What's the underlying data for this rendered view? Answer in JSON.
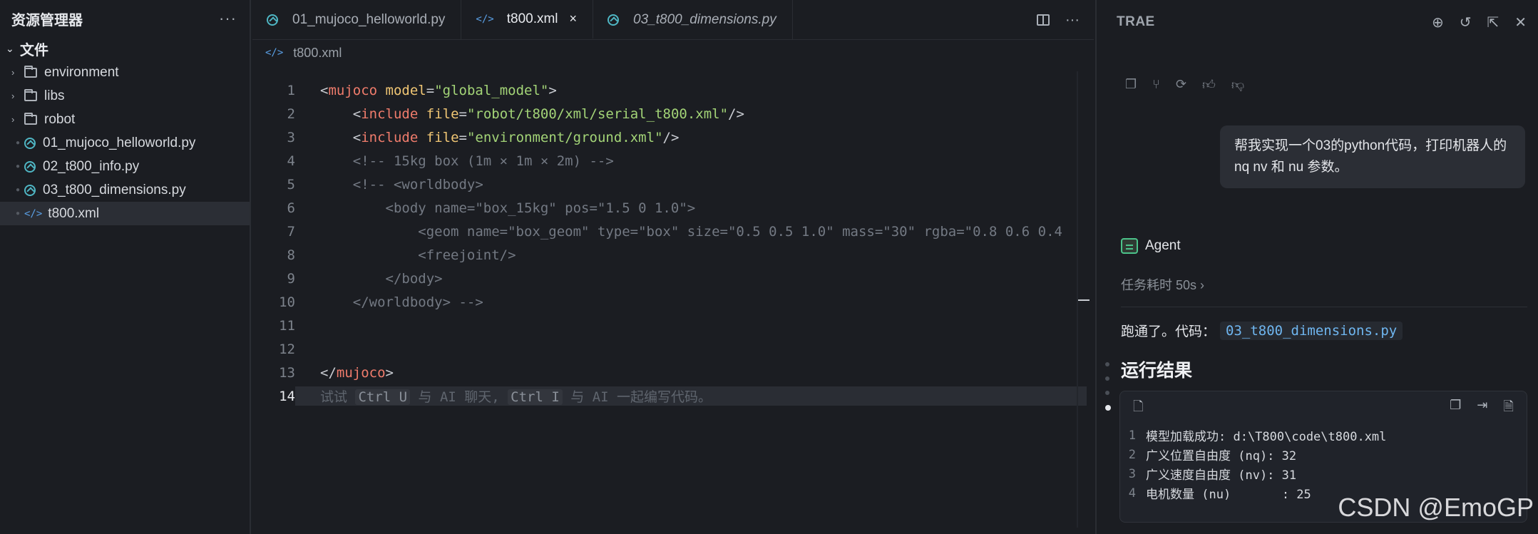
{
  "sidebar": {
    "title": "资源管理器",
    "more": "···",
    "root": "文件",
    "items": [
      {
        "type": "folder",
        "label": "environment"
      },
      {
        "type": "folder",
        "label": "libs"
      },
      {
        "type": "folder",
        "label": "robot"
      },
      {
        "type": "py",
        "label": "01_mujoco_helloworld.py"
      },
      {
        "type": "py",
        "label": "02_t800_info.py"
      },
      {
        "type": "py",
        "label": "03_t800_dimensions.py"
      },
      {
        "type": "xml",
        "label": "t800.xml"
      }
    ]
  },
  "editor": {
    "tabs": [
      {
        "label": "01_mujoco_helloworld.py"
      },
      {
        "label": "t800.xml",
        "close": "×"
      },
      {
        "label": "03_t800_dimensions.py"
      }
    ],
    "tab_more": "···",
    "breadcrumb": "t800.xml",
    "xml_glyph": "</>",
    "line_numbers": [
      "1",
      "2",
      "3",
      "4",
      "5",
      "6",
      "7",
      "8",
      "9",
      "10",
      "11",
      "12",
      "13",
      "14"
    ],
    "lines": {
      "l1": {
        "a": "<",
        "b": "mujoco",
        "c": " ",
        "d": "model",
        "e": "=",
        "f": "\"global_model\"",
        "g": ">"
      },
      "l2": {
        "indent": "    ",
        "a": "<",
        "b": "include",
        "c": " ",
        "d": "file",
        "e": "=",
        "f": "\"robot/t800/xml/serial_t800.xml\"",
        "g": "/>"
      },
      "l3": {
        "indent": "    ",
        "a": "<",
        "b": "include",
        "c": " ",
        "d": "file",
        "e": "=",
        "f": "\"environment/ground.xml\"",
        "g": "/>"
      },
      "l4": "    <!-- 15kg box (1m × 1m × 2m) -->",
      "l5": "    <!-- <worldbody>",
      "l6": "        <body name=\"box_15kg\" pos=\"1.5 0 1.0\">",
      "l7": "            <geom name=\"box_geom\" type=\"box\" size=\"0.5 0.5 1.0\" mass=\"30\" rgba=\"0.8 0.6 0.4",
      "l8": "            <freejoint/>",
      "l9": "        </body>",
      "l10": "    </worldbody> -->",
      "l13": {
        "a": "</",
        "b": "mujoco",
        "g": ">"
      },
      "l14": {
        "p1": "试试 ",
        "k1": "Ctrl U",
        "p2": " 与 AI 聊天, ",
        "k2": "Ctrl I",
        "p3": " 与 AI 一起编写代码。"
      }
    }
  },
  "panel": {
    "title": "TRAE",
    "user_message": "帮我实现一个03的python代码，打印机器人的 nq nv 和 nu 参数。",
    "agent_name": "Agent",
    "timing": "任务耗时 50s",
    "ran_text": "跑通了。代码：",
    "ran_file": "03_t800_dimensions.py",
    "result_title": "运行结果",
    "output": [
      {
        "n": "1",
        "text": "模型加载成功: d:\\T800\\code\\t800.xml"
      },
      {
        "n": "2",
        "text": "广义位置自由度 (nq): 32"
      },
      {
        "n": "3",
        "text": "广义速度自由度 (nv): 31"
      },
      {
        "n": "4",
        "text": "电机数量 (nu)       : 25"
      }
    ]
  },
  "watermark": "CSDN @EmoGP",
  "colors": {
    "tag": "#f07c6c",
    "attr": "#f0c674",
    "string": "#a3d477",
    "comment": "#737983",
    "accent": "#4fb6c4"
  }
}
